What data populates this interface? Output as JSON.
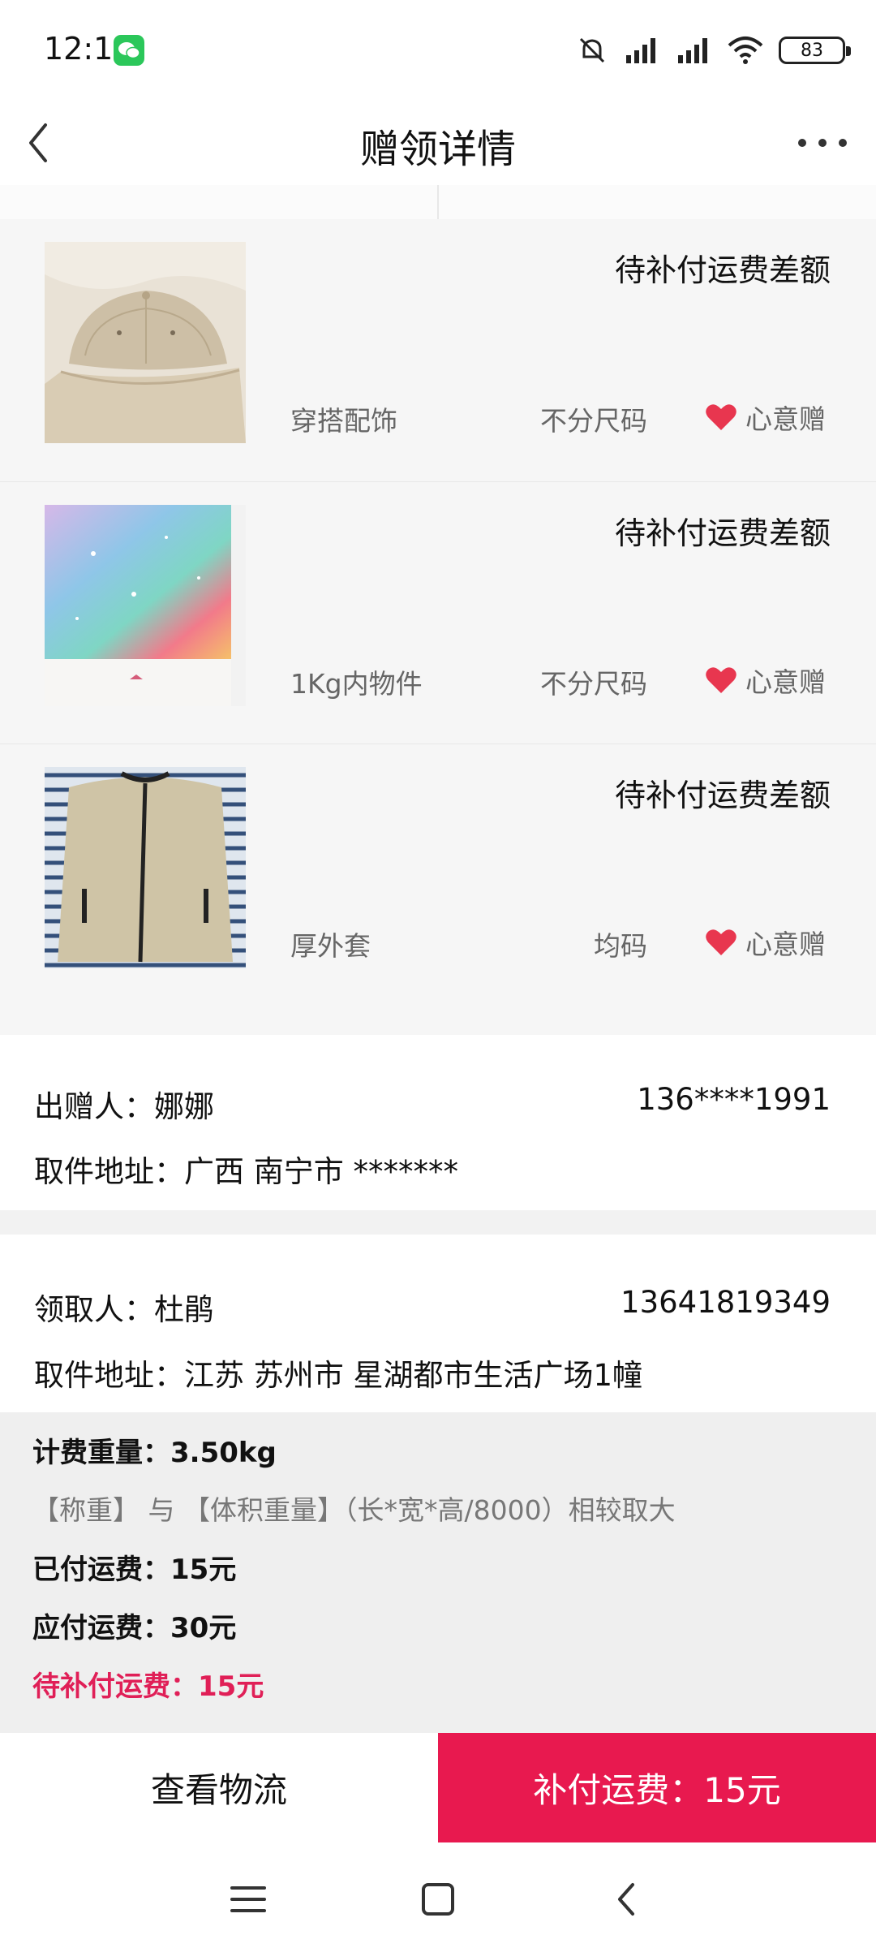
{
  "status_bar": {
    "time": "12:11",
    "battery": "83",
    "icons": [
      "wechat-icon",
      "mute-icon",
      "signal-icon",
      "signal-hd-icon",
      "wifi-icon",
      "battery-icon"
    ]
  },
  "nav": {
    "title": "赠领详情"
  },
  "items": [
    {
      "status": "待补付运费差额",
      "category": "穿搭配饰",
      "size": "不分尺码",
      "tag": "心意赠",
      "image": "beige-cap-photo"
    },
    {
      "status": "待补付运费差额",
      "category": "1Kg内物件",
      "size": "不分尺码",
      "tag": "心意赠",
      "image": "galaxy-notebook-photo"
    },
    {
      "status": "待补付运费差额",
      "category": "厚外套",
      "size": "均码",
      "tag": "心意赠",
      "image": "fleece-jacket-photo"
    }
  ],
  "giver": {
    "name_label": "出赠人：娜娜",
    "phone": "136****1991",
    "address": "取件地址：广西 南宁市 *******"
  },
  "receiver": {
    "name_label": "领取人：杜鹃",
    "phone": "13641819349",
    "address": "取件地址：江苏 苏州市 星湖都市生活广场1幢"
  },
  "fee": {
    "weight": "计费重量：3.50kg",
    "note": "【称重】 与 【体积重量】（长*宽*高/8000）相较取大",
    "paid": "已付运费：15元",
    "due": "应付运费：30元",
    "pending": "待补付运费：15元"
  },
  "actions": {
    "logistics": "查看物流",
    "pay": "补付运费：15元"
  },
  "colors": {
    "accent": "#e8194f",
    "pending_text": "#e01f57",
    "heart": "#e8364f"
  }
}
